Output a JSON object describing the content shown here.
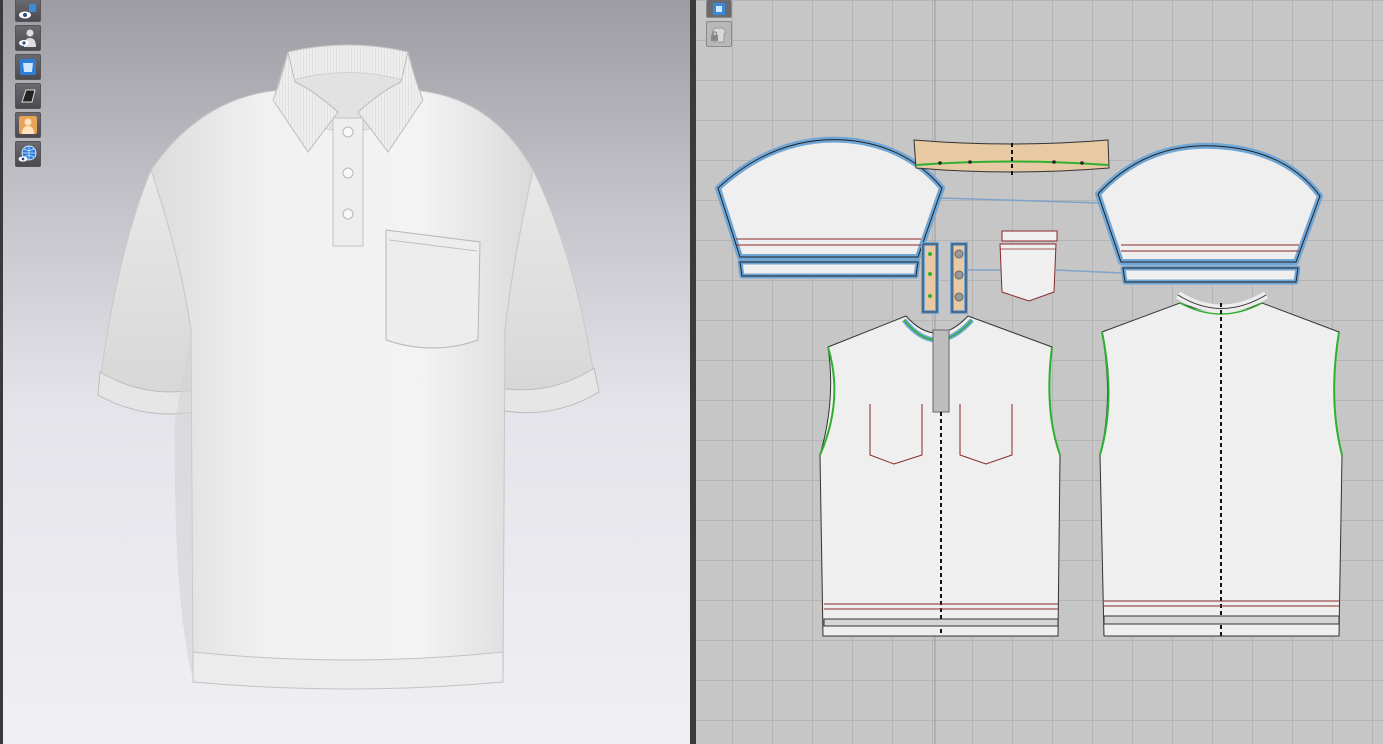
{
  "colors": {
    "grid_bg": "#c6c6c6",
    "pattern_fill": "#efefef",
    "selection_outline": "#6fa6d6",
    "seam_green": "#2fb12f",
    "stitch_red": "#8a2a2a",
    "fold_line": "#111111",
    "fusible_tan": "#e7c9a3"
  },
  "toolbar_3d": {
    "tools": [
      {
        "icon": "show-avatar-eye-icon"
      },
      {
        "icon": "show-avatar-person-icon"
      },
      {
        "icon": "show-garment-icon"
      },
      {
        "icon": "show-garment-outline-icon"
      },
      {
        "icon": "avatar-skin-icon"
      },
      {
        "icon": "environment-globe-icon"
      }
    ]
  },
  "toolbar_2d": {
    "tools": [
      {
        "icon": "show-pattern-icon"
      },
      {
        "icon": "lock-pattern-icon"
      }
    ]
  },
  "garment": {
    "type": "polo-shirt",
    "color": "#f1f1f1",
    "buttons": 3,
    "pocket": true
  },
  "pattern_pieces": [
    {
      "name": "left-sleeve",
      "selected": true
    },
    {
      "name": "right-sleeve",
      "selected": true
    },
    {
      "name": "collar",
      "fusible": true
    },
    {
      "name": "placket-left",
      "selected": true
    },
    {
      "name": "placket-right",
      "selected": true
    },
    {
      "name": "pocket"
    },
    {
      "name": "front-body"
    },
    {
      "name": "back-body"
    }
  ]
}
